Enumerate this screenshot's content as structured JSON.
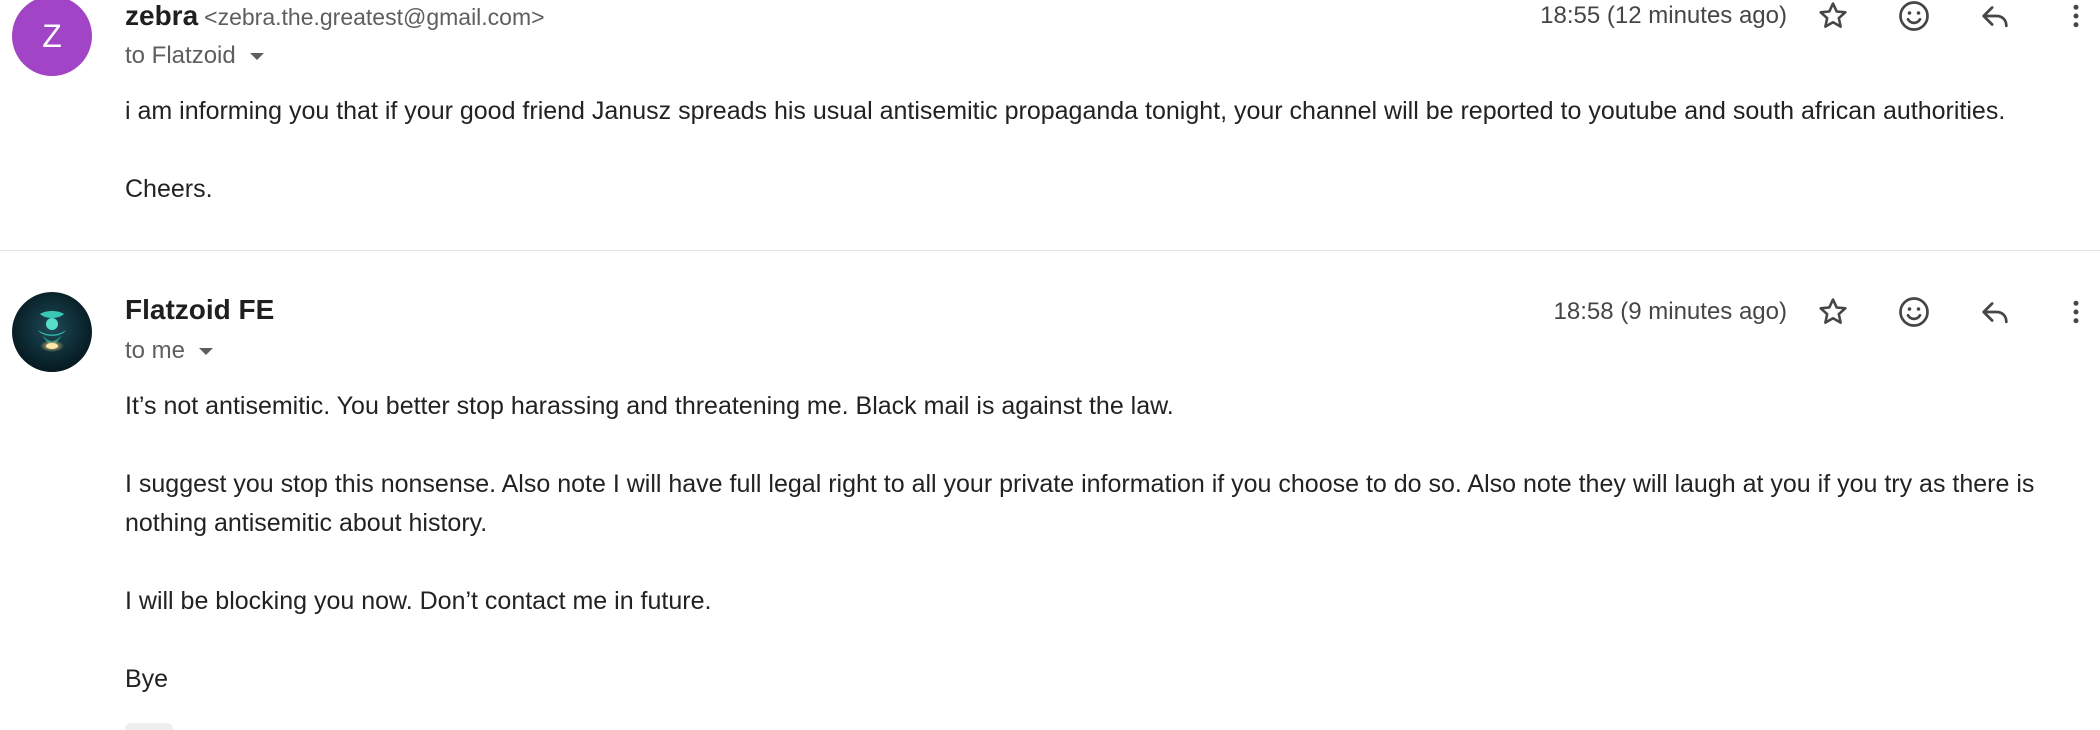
{
  "messages": [
    {
      "avatar_letter": "Z",
      "avatar_color": "#a144c5",
      "sender_name": "zebra",
      "sender_email": "<zebra.the.greatest@gmail.com>",
      "recipient": "to Flatzoid",
      "timestamp": "18:55 (12 minutes ago)",
      "paragraphs": [
        "i am informing you that if your good friend Janusz spreads his usual antisemitic propaganda tonight, your channel will be reported to youtube and south african authorities.",
        "Cheers."
      ]
    },
    {
      "avatar_letter": "",
      "sender_name": "Flatzoid FE",
      "sender_email": "",
      "recipient": "to me",
      "timestamp": "18:58 (9 minutes ago)",
      "paragraphs": [
        "It’s not antisemitic. You better stop harassing and threatening me. Black mail is against the law.",
        "I suggest you stop this nonsense. Also note I will have full legal right to all your private information if you choose to do so. Also note they will laugh at you if you try as there is nothing antisemitic about history.",
        "I will be blocking you now. Don’t contact me in future.",
        "Bye"
      ]
    }
  ],
  "icons": {
    "star": "star-icon",
    "emoji": "emoji-icon",
    "reply": "reply-icon",
    "more": "more-vertical-icon"
  }
}
